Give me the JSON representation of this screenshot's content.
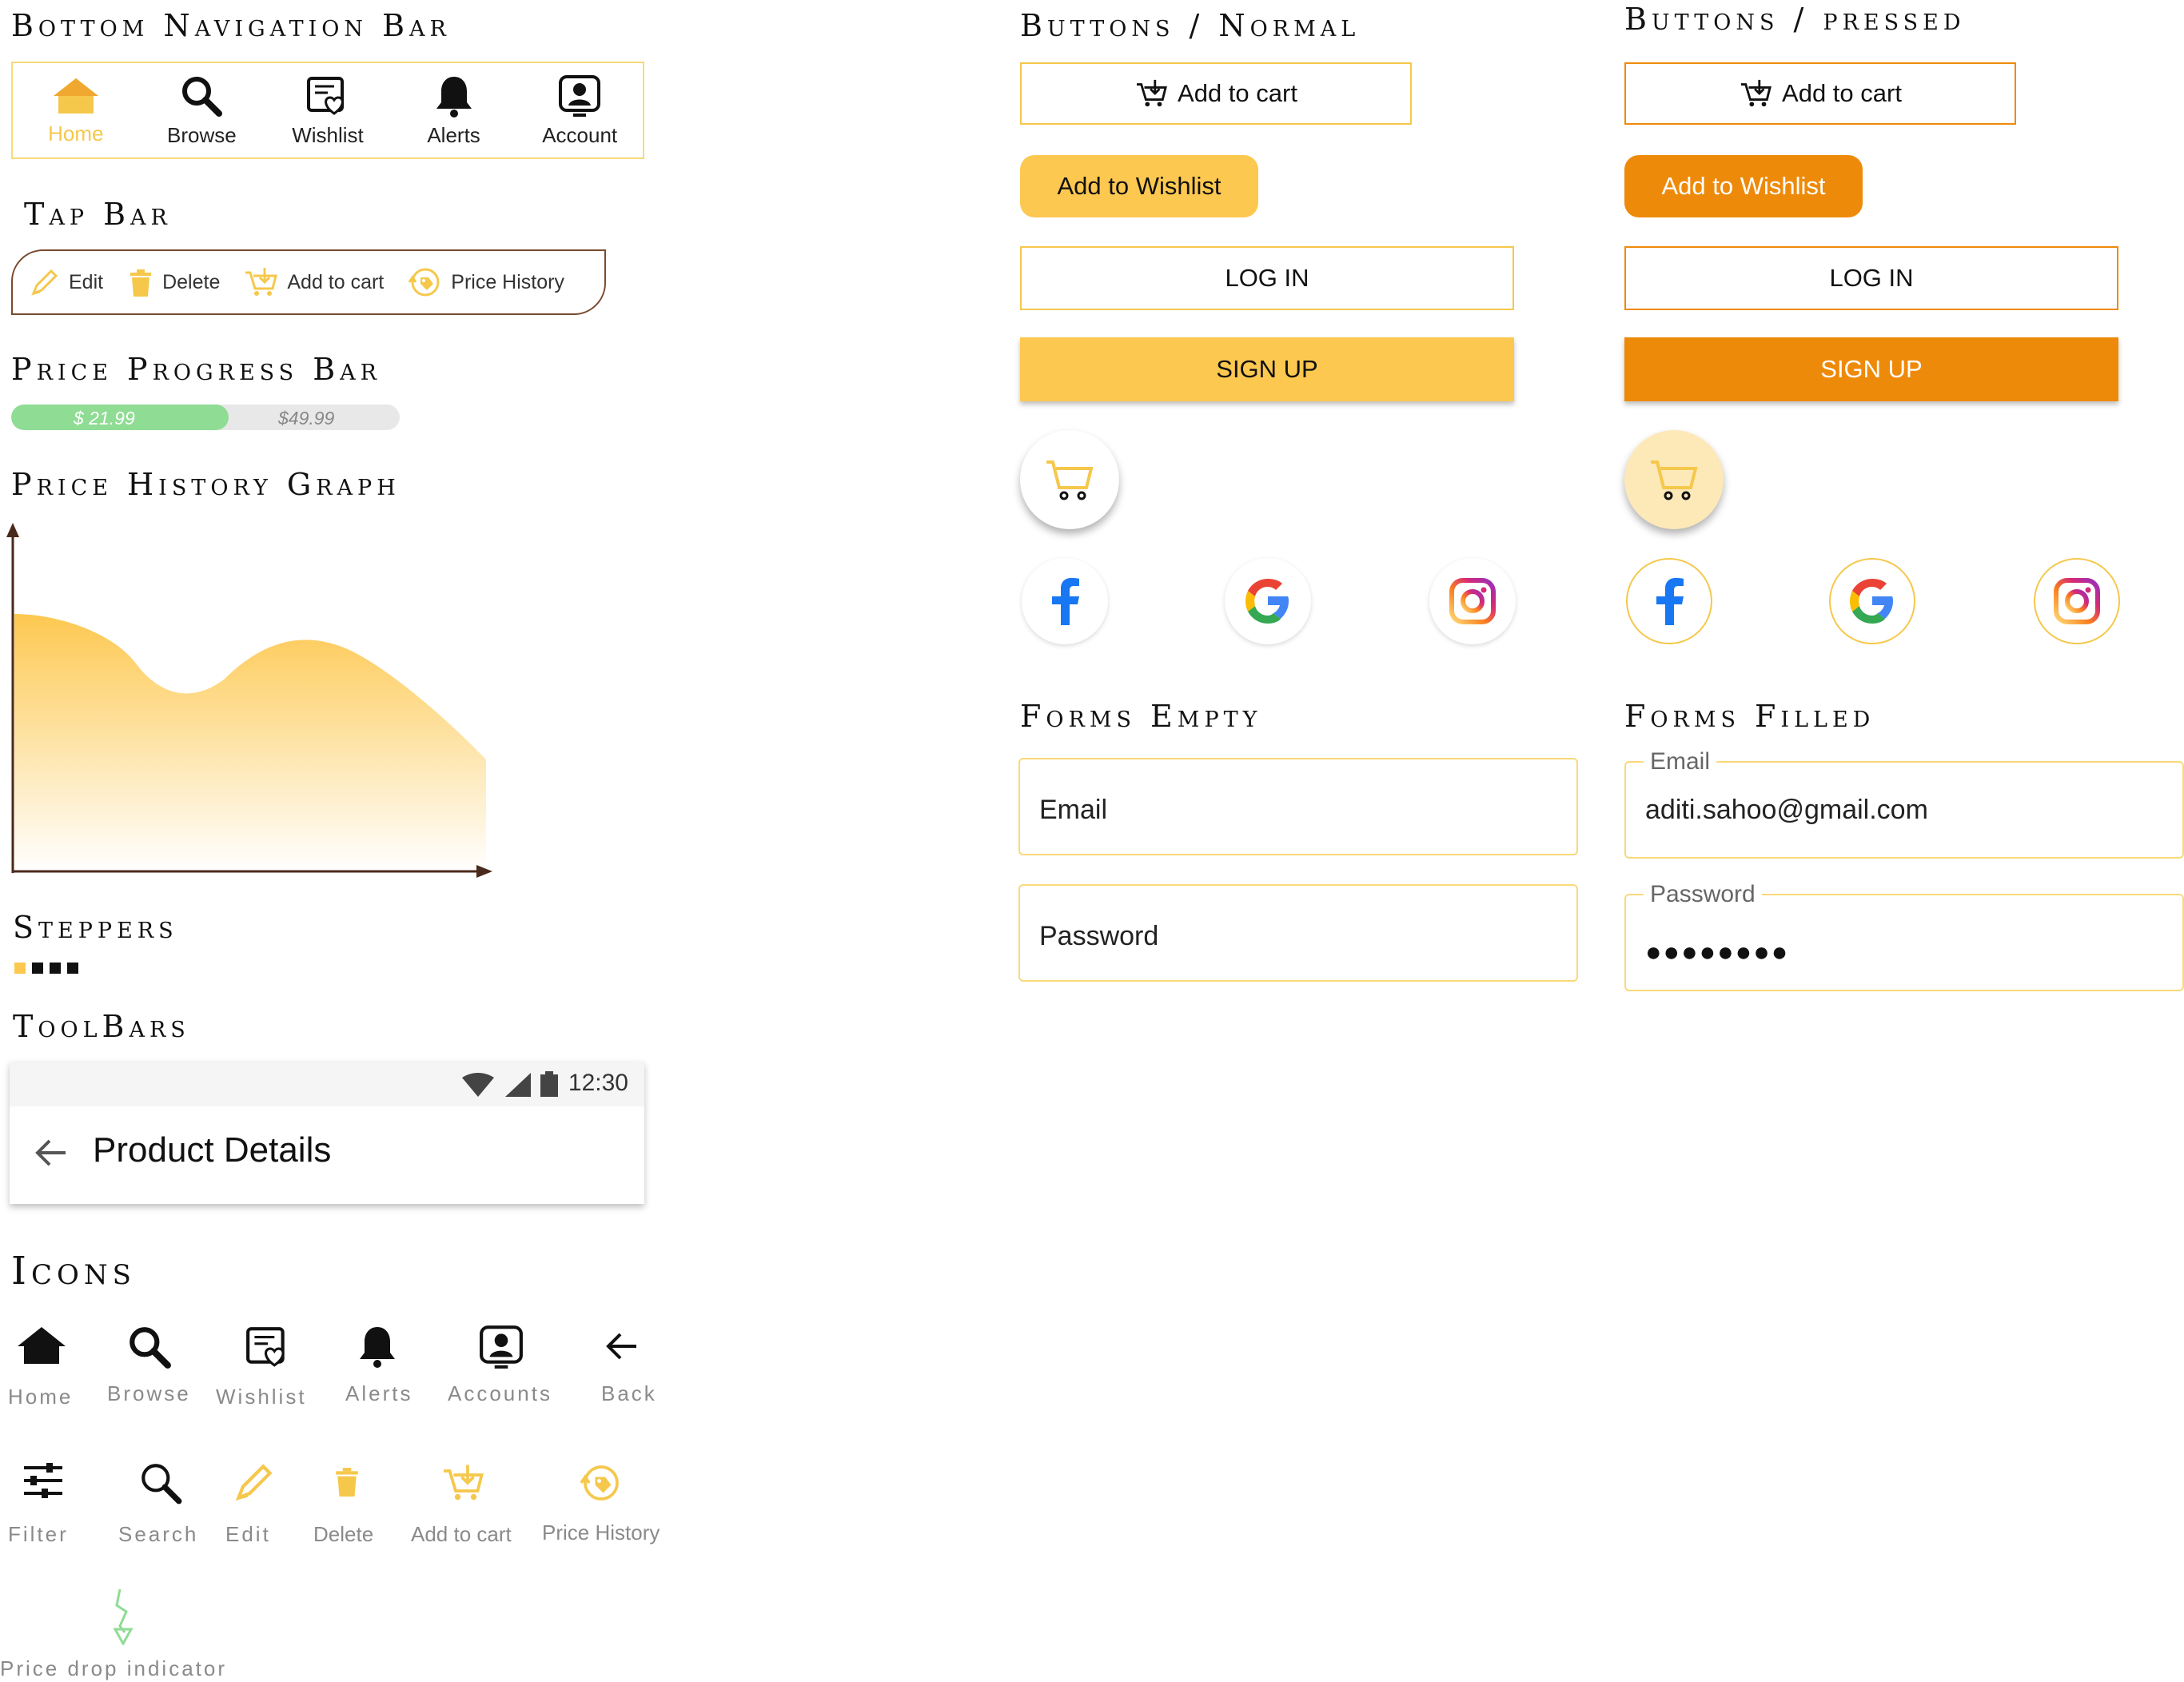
{
  "sections": {
    "bottom_nav": "Bottom Navigation Bar",
    "tap_bar": "Tap Bar",
    "price_progress": "Price Progress Bar",
    "price_history_graph": "Price History Graph",
    "steppers": "Steppers",
    "toolbars": "ToolBars",
    "icons": "Icons",
    "buttons_normal": "Buttons / Normal",
    "buttons_pressed": "Buttons / pressed",
    "forms_empty": "Forms Empty",
    "forms_filled": "Forms Filled"
  },
  "bottom_nav": {
    "items": [
      {
        "label": "Home",
        "icon": "home-icon",
        "active": true
      },
      {
        "label": "Browse",
        "icon": "search-icon"
      },
      {
        "label": "Wishlist",
        "icon": "wishlist-icon"
      },
      {
        "label": "Alerts",
        "icon": "bell-icon"
      },
      {
        "label": "Account",
        "icon": "account-icon"
      }
    ]
  },
  "tap_bar": {
    "items": [
      {
        "label": "Edit",
        "icon": "pencil-icon"
      },
      {
        "label": "Delete",
        "icon": "trash-icon"
      },
      {
        "label": "Add to cart",
        "icon": "cart-add-icon"
      },
      {
        "label": "Price History",
        "icon": "price-tag-icon"
      }
    ]
  },
  "price_progress": {
    "current": "$ 21.99",
    "original": "$49.99",
    "fill_fraction": 0.56
  },
  "steppers": {
    "total": 4,
    "active": 1
  },
  "toolbar": {
    "time": "12:30",
    "title": "Product Details"
  },
  "icons": {
    "row1": [
      "Home",
      "Browse",
      "Wishlist",
      "Alerts",
      "Accounts",
      "Back"
    ],
    "row2": [
      "Filter",
      "Search",
      "Edit",
      "Delete",
      "Add to cart",
      "Price History"
    ],
    "row3": [
      "Price drop indicator"
    ]
  },
  "buttons": {
    "add_to_cart": "Add to cart",
    "add_to_wishlist": "Add to Wishlist",
    "login": "LOG IN",
    "signup": "SIGN UP"
  },
  "forms_empty": {
    "email_placeholder": "Email",
    "password_placeholder": "Password"
  },
  "forms_filled": {
    "email_label": "Email",
    "email_value": "aditi.sahoo@gmail.com",
    "password_label": "Password",
    "password_value": "●●●●●●●●"
  },
  "colors": {
    "accent": "#fdc850",
    "pressed": "#ee8a0a",
    "progress": "#8fdc94",
    "graph": "#f5c84c"
  }
}
